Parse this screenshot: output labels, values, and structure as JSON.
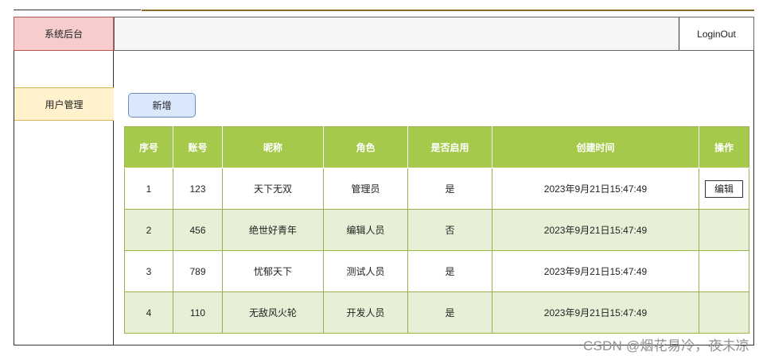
{
  "sidebar": {
    "brand": "系统后台",
    "items": [
      {
        "label": "用户管理"
      }
    ]
  },
  "header": {
    "logout_label": "LoginOut"
  },
  "toolbar": {
    "add_label": "新增"
  },
  "table": {
    "columns": [
      "序号",
      "账号",
      "昵称",
      "角色",
      "是否启用",
      "创建时间",
      "操作"
    ],
    "rows": [
      {
        "index": "1",
        "account": "123",
        "nickname": "天下无双",
        "role": "管理员",
        "enabled": "是",
        "created": "2023年9月21日15:47:49",
        "action": "编辑"
      },
      {
        "index": "2",
        "account": "456",
        "nickname": "绝世好青年",
        "role": "编辑人员",
        "enabled": "否",
        "created": "2023年9月21日15:47:49",
        "action": ""
      },
      {
        "index": "3",
        "account": "789",
        "nickname": "忧郁天下",
        "role": "测试人员",
        "enabled": "是",
        "created": "2023年9月21日15:47:49",
        "action": ""
      },
      {
        "index": "4",
        "account": "110",
        "nickname": "无敌风火轮",
        "role": "开发人员",
        "enabled": "是",
        "created": "2023年9月21日15:47:49",
        "action": ""
      }
    ]
  },
  "watermark": "CSDN @烟花易冷，夜未凉",
  "colors": {
    "brand_bg": "#f6cccc",
    "sidebar_active_bg": "#fff2cc",
    "add_button_bg": "#dae8fc",
    "table_header_bg": "#a5c94a",
    "table_alt_row_bg": "#e7f0d7"
  }
}
